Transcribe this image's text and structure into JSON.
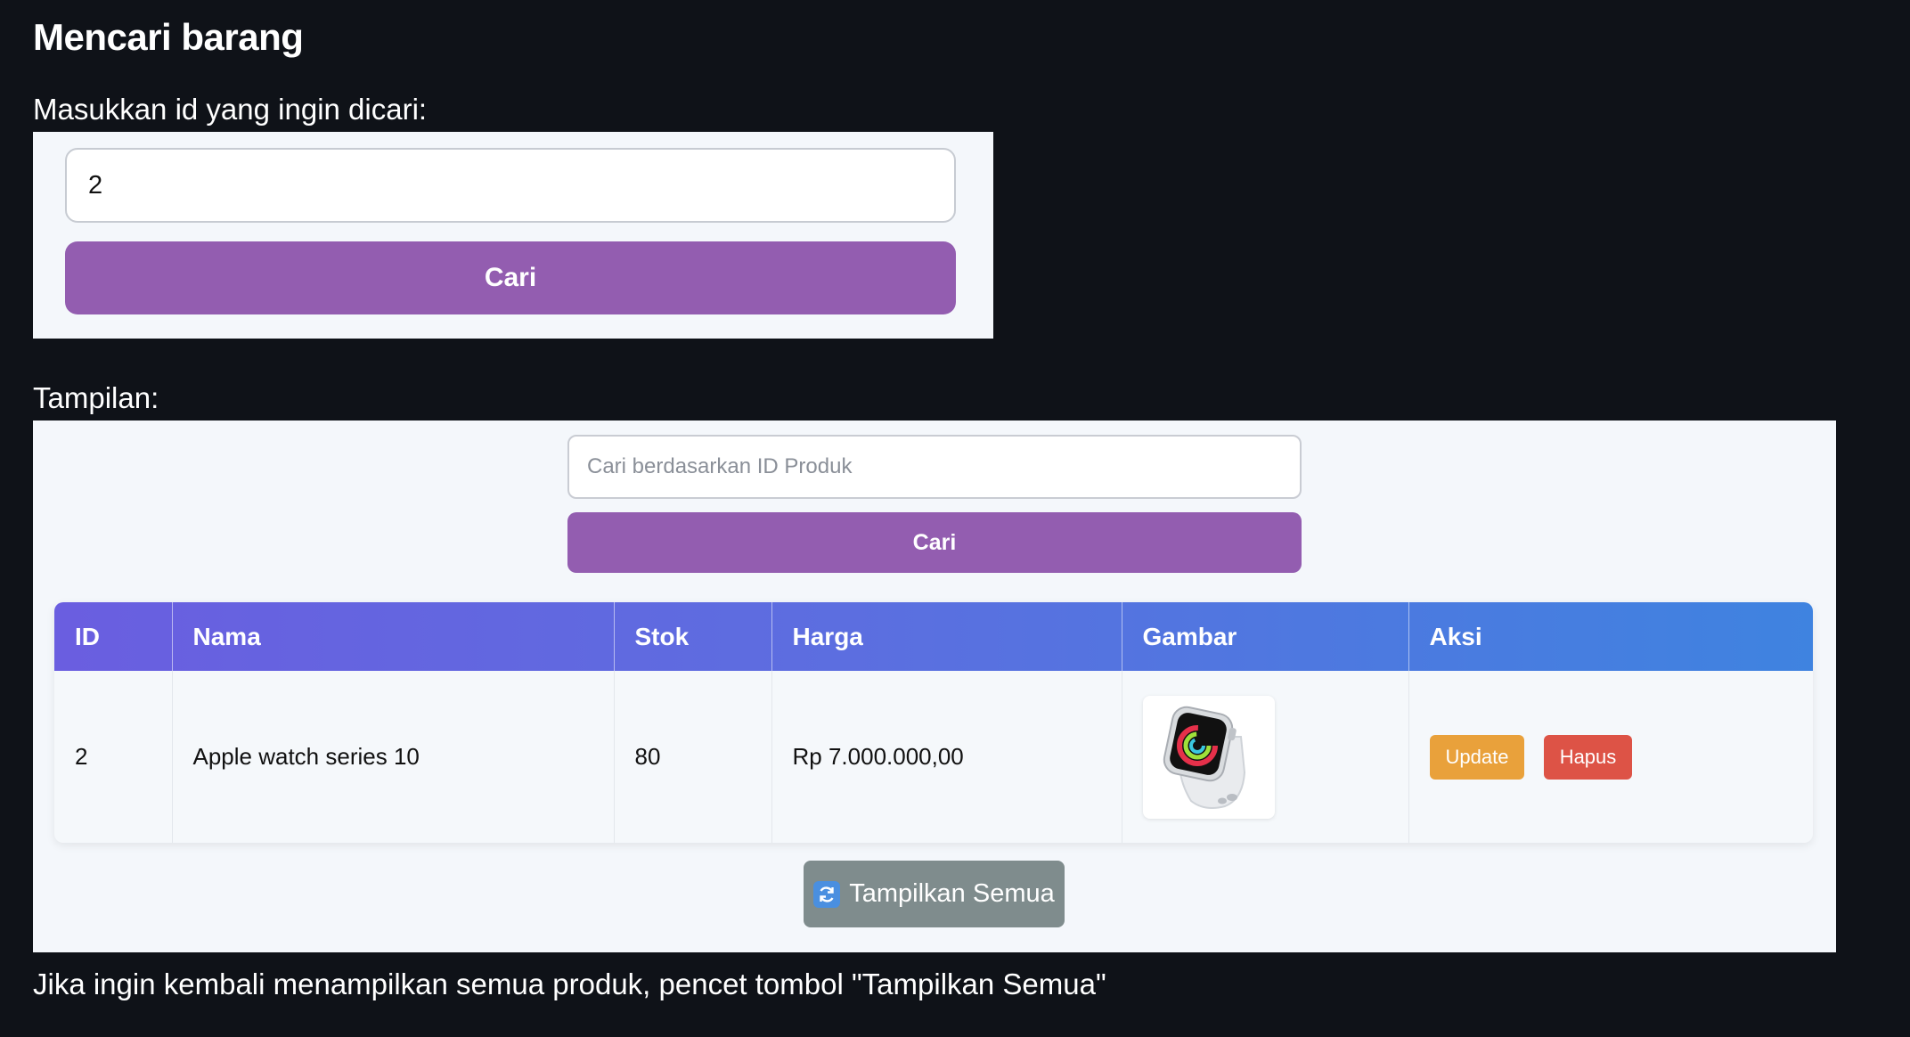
{
  "page": {
    "title": "Mencari barang",
    "search_label": "Masukkan id yang ingin dicari:",
    "view_label": "Tampilan:",
    "footer_note": "Jika ingin kembali menampilkan semua produk, pencet tombol \"Tampilkan Semua\""
  },
  "search_form": {
    "input_value": "2",
    "button_label": "Cari"
  },
  "preview": {
    "search_placeholder": "Cari berdasarkan ID Produk",
    "search_value": "",
    "search_button": "Cari",
    "show_all_button": "Tampilkan Semua",
    "table": {
      "headers": [
        "ID",
        "Nama",
        "Stok",
        "Harga",
        "Gambar",
        "Aksi"
      ],
      "rows": [
        {
          "id": "2",
          "nama": "Apple watch series 10",
          "stok": "80",
          "harga": "Rp 7.000.000,00",
          "gambar": "apple-watch-icon",
          "actions": {
            "update": "Update",
            "delete": "Hapus"
          }
        }
      ]
    }
  },
  "colors": {
    "page_bg": "#0f1218",
    "card_bg": "#f4f7fb",
    "primary_button": "#935db0",
    "header_gradient_start": "#6a5ee0",
    "header_gradient_end": "#3f83e0",
    "update_button": "#e9a13b",
    "delete_button": "#dd5346",
    "show_all_button": "#7f8c8d"
  }
}
